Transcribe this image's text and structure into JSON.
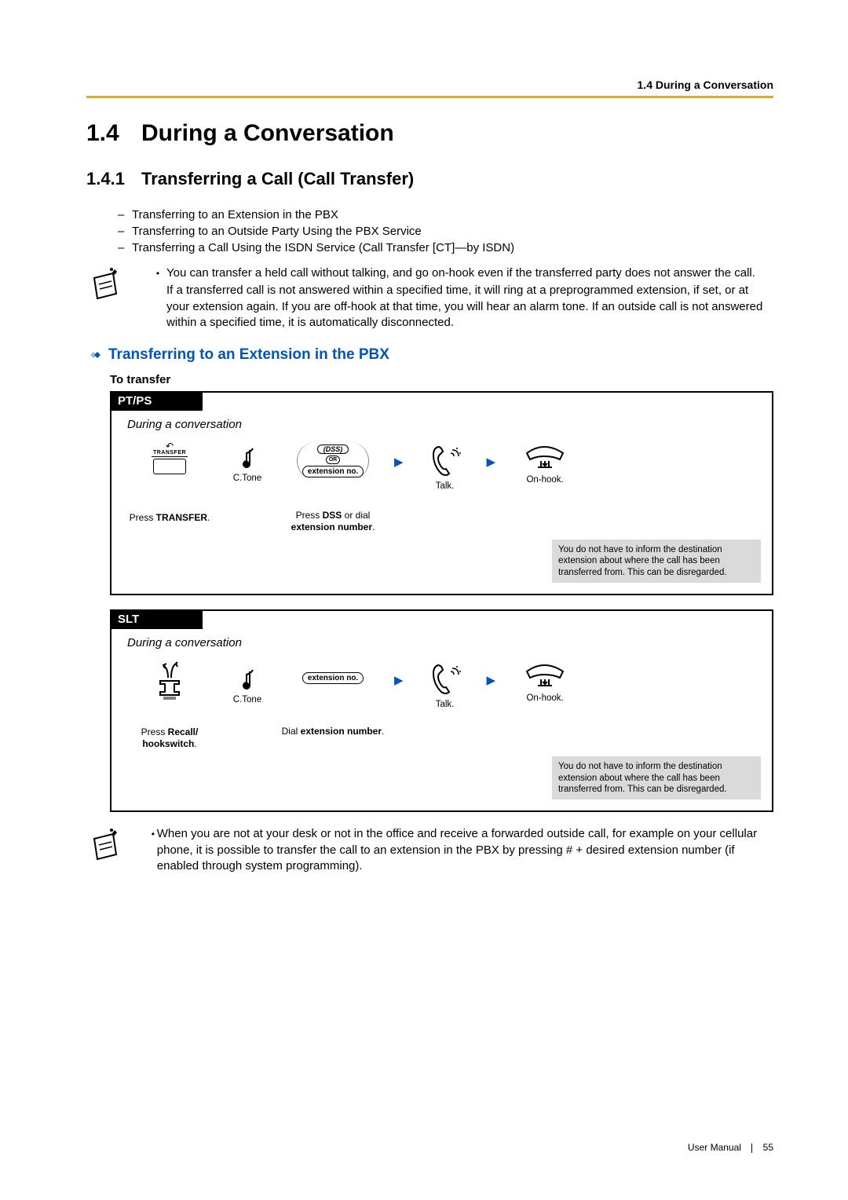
{
  "header": {
    "running": "1.4 During a Conversation"
  },
  "title": {
    "num": "1.4",
    "text": "During a Conversation"
  },
  "subtitle": {
    "num": "1.4.1",
    "text": "Transferring a Call (Call Transfer)"
  },
  "dashlist": [
    "Transferring to an Extension in the PBX",
    "Transferring to an Outside Party Using the PBX Service",
    "Transferring a Call Using the ISDN Service (Call Transfer [CT]—by ISDN)"
  ],
  "note1": {
    "bullet": "You can transfer a held call without talking, and go on-hook even if the transferred party does not answer the call.",
    "para": "If a transferred call is not answered within a specified time, it will ring at a preprogrammed extension, if set, or at your extension again. If you are off-hook at that time, you will hear an alarm tone. If an outside call is not answered within a specified time, it is automatically disconnected."
  },
  "blue_heading": "Transferring to an Extension in the PBX",
  "to_transfer": "To transfer",
  "ptps": {
    "tab": "PT/PS",
    "context": "During a conversation",
    "transfer_key": "TRANSFER",
    "ctone": "C.Tone",
    "dss": "(DSS)",
    "or": "OR",
    "ext_no": "extension no.",
    "talk": "Talk.",
    "onhook": "On-hook.",
    "cap1_a": "Press ",
    "cap1_b": "TRANSFER",
    "cap1_c": ".",
    "cap2_a": "Press ",
    "cap2_b": "DSS",
    "cap2_c": " or dial",
    "cap2_d": "extension number",
    "cap2_e": ".",
    "grey": "You do not have to inform the destination extension about where the call has been transferred from. This can be disregarded."
  },
  "slt": {
    "tab": "SLT",
    "context": "During a conversation",
    "ctone": "C.Tone",
    "ext_no": "extension no.",
    "talk": "Talk.",
    "onhook": "On-hook.",
    "cap1_a": "Press ",
    "cap1_b": "Recall/",
    "cap1_c": "hookswitch",
    "cap1_d": ".",
    "cap2_a": "Dial ",
    "cap2_b": "extension number",
    "cap2_c": ".",
    "grey": "You do not have to inform the destination extension about where the call has been transferred from. This can be disregarded."
  },
  "note2": "When you are not at your desk or not in the office and receive a forwarded outside call, for example on your cellular phone, it is possible to transfer the call to an extension in the PBX by pressing # + desired extension number (if enabled through system programming).",
  "footer": {
    "manual": "User Manual",
    "page": "55"
  }
}
